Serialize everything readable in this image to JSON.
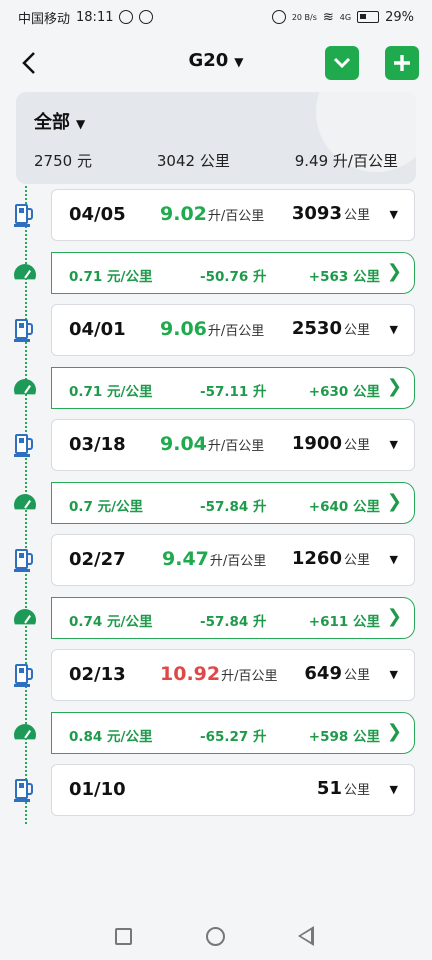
{
  "status_bar": {
    "carrier": "中国移动",
    "time": "18:11",
    "net_speed": "20 B/s",
    "network": "4G",
    "battery": "29%"
  },
  "header": {
    "title": "G20",
    "back_icon": "chevron-left-icon",
    "dropdown_icon": "chevron-down-icon",
    "add_icon": "plus-icon",
    "accent_color": "#1faa4d"
  },
  "summary": {
    "filter": "全部",
    "total_cost": "2750 元",
    "total_distance": "3042 公里",
    "avg_consumption": "9.49 升/百公里"
  },
  "entries": [
    {
      "date": "04/05",
      "consumption": "9.02",
      "consumption_unit": "升/百公里",
      "distance": "3093",
      "distance_unit": "公里",
      "status": "normal"
    },
    {
      "date": "04/01",
      "consumption": "9.06",
      "consumption_unit": "升/百公里",
      "distance": "2530",
      "distance_unit": "公里",
      "status": "normal"
    },
    {
      "date": "03/18",
      "consumption": "9.04",
      "consumption_unit": "升/百公里",
      "distance": "1900",
      "distance_unit": "公里",
      "status": "normal"
    },
    {
      "date": "02/27",
      "consumption": "9.47",
      "consumption_unit": "升/百公里",
      "distance": "1260",
      "distance_unit": "公里",
      "status": "normal"
    },
    {
      "date": "02/13",
      "consumption": "10.92",
      "consumption_unit": "升/百公里",
      "distance": "649",
      "distance_unit": "公里",
      "status": "high"
    },
    {
      "date": "01/10",
      "consumption": "",
      "consumption_unit": "",
      "distance": "51",
      "distance_unit": "公里",
      "status": "none"
    }
  ],
  "segments": [
    {
      "cost_per_km": "0.71 元/公里",
      "fuel_delta": "-50.76 升",
      "distance_delta": "+563 公里"
    },
    {
      "cost_per_km": "0.71 元/公里",
      "fuel_delta": "-57.11 升",
      "distance_delta": "+630 公里"
    },
    {
      "cost_per_km": "0.7 元/公里",
      "fuel_delta": "-57.84 升",
      "distance_delta": "+640 公里"
    },
    {
      "cost_per_km": "0.74 元/公里",
      "fuel_delta": "-57.84 升",
      "distance_delta": "+611 公里"
    },
    {
      "cost_per_km": "0.84 元/公里",
      "fuel_delta": "-65.27 升",
      "distance_delta": "+598 公里"
    }
  ],
  "icons": {
    "refuel": "fuel-pump-icon",
    "segment": "speedometer-icon",
    "expand": "caret-down-icon",
    "detail": "chevron-right-icon"
  },
  "colors": {
    "good": "#1faa4d",
    "warning": "#e04848",
    "pump": "#2f6fc0"
  }
}
